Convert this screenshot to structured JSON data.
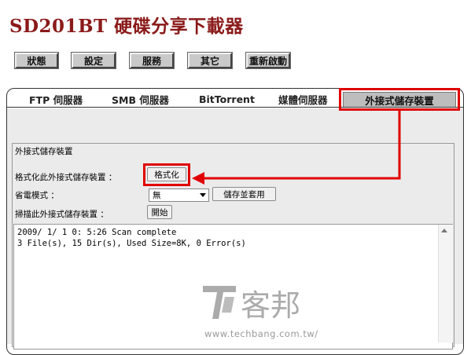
{
  "header": {
    "title": "SD201BT 硬碟分享下載器"
  },
  "nav": {
    "status": "狀態",
    "settings": "設定",
    "services": "服務",
    "other": "其它",
    "reboot": "重新啟動"
  },
  "tabs": {
    "ftp": "FTP 伺服器",
    "smb": "SMB 伺服器",
    "bittorrent": "BitTorrent",
    "media": "媒體伺服器",
    "external": "外接式儲存裝置"
  },
  "storage": {
    "legend": "外接式儲存裝置",
    "format_label": "格式化此外接式儲存裝置 ：",
    "format_button": "格式化",
    "powersave_label": "省電模式 ：",
    "powersave_value": "無",
    "save_apply_button": "儲存並套用",
    "scan_label": "掃描此外接式儲存裝置 ：",
    "scan_button": "開始",
    "log_lines": [
      "2009/ 1/ 1  0: 5:26 Scan complete",
      "3 File(s), 15 Dir(s), Used Size=8K, 0 Error(s)"
    ]
  },
  "watermark": {
    "brand": "客邦",
    "url": "www.techbang.com.tw/"
  },
  "colors": {
    "title": "#8b1a1a",
    "highlight": "#e00000",
    "panel_bg": "#ebebeb"
  }
}
